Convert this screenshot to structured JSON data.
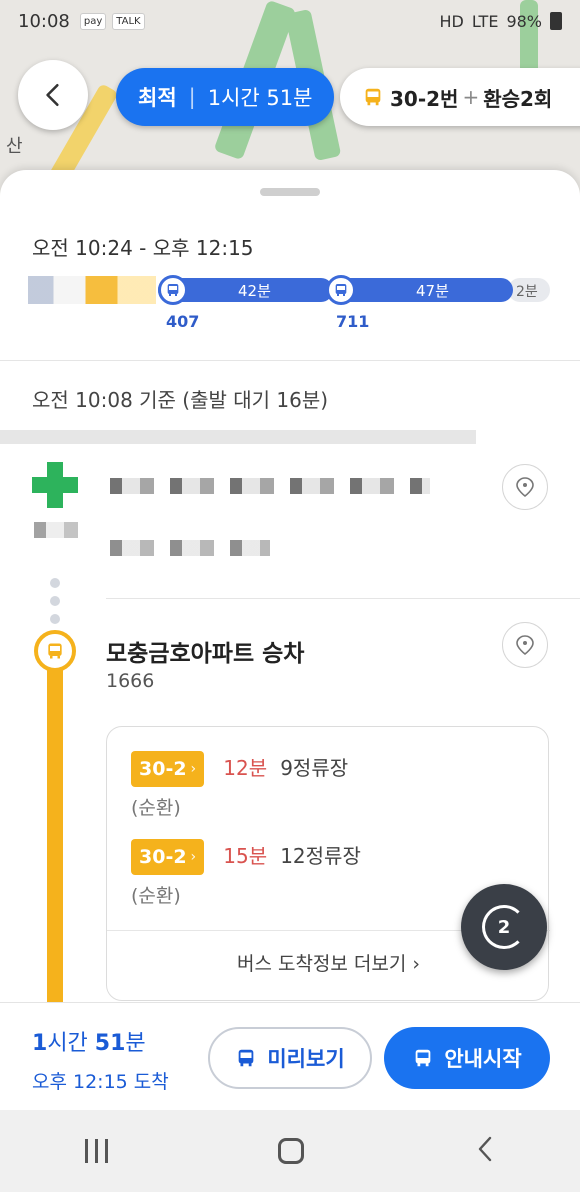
{
  "status_bar": {
    "time": "10:08",
    "battery": "98%",
    "network": "LTE",
    "volte": "HD",
    "app_icon_1": "pay",
    "app_icon_2": "TALK"
  },
  "map": {
    "place_label": "산"
  },
  "top_controls": {
    "route_type": "최적",
    "route_duration": "1시간 51분",
    "route_summary_bus": "30-2번",
    "route_summary_plus": "+",
    "route_summary_transfer": "환승2회"
  },
  "trip": {
    "time_range": "오전 10:24 - 오후 12:15",
    "segments": [
      {
        "bus": "407",
        "minutes": "42분"
      },
      {
        "bus": "711",
        "minutes": "47분"
      }
    ],
    "walk_end": "2분",
    "departure_note": "오전 10:08 기준 (출발 대기 16분)"
  },
  "stop": {
    "name": "모충금호아파트 승차",
    "id": "1666",
    "arrivals": [
      {
        "route": "30-2",
        "eta": "12분",
        "stops": "9정류장",
        "type": "(순환)"
      },
      {
        "route": "30-2",
        "eta": "15분",
        "stops": "12정류장",
        "type": "(순환)"
      }
    ],
    "more_label": "버스 도착정보 더보기",
    "more_chevron": "›"
  },
  "refresh": {
    "count": "2"
  },
  "bottom_bar": {
    "hours": "1",
    "hours_unit": "시간",
    "minutes": "51",
    "minutes_unit": "분",
    "arrival": "오후 12:15 도착",
    "preview_label": "미리보기",
    "start_label": "안내시작"
  },
  "colors": {
    "primary_blue": "#1a73f0",
    "bus_yellow": "#f5b21c",
    "start_green": "#2db35c",
    "eta_red": "#d9534f"
  }
}
